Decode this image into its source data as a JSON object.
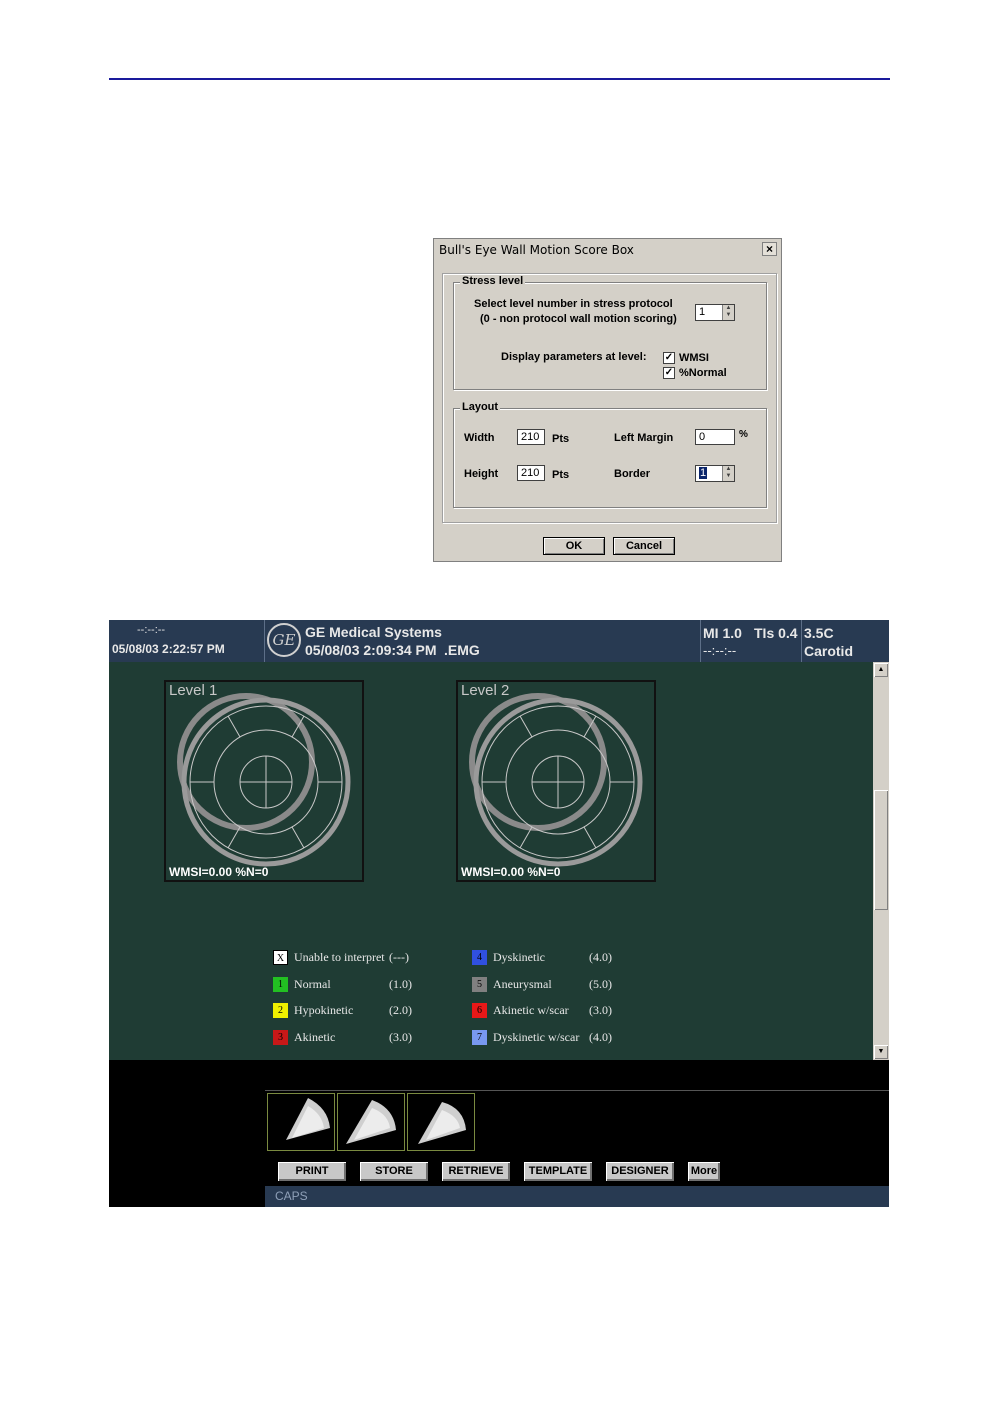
{
  "dialog": {
    "title": "Bull's Eye Wall Motion Score Box",
    "close_label": "×",
    "stress": {
      "legend": "Stress level",
      "prompt_line1": "Select level number in stress protocol",
      "prompt_line2": "(0 - non protocol wall motion scoring)",
      "level_value": "1",
      "display_label": "Display parameters at level:",
      "wmsi_label": "WMSI",
      "wmsi_checked": true,
      "normal_label": "%Normal",
      "normal_checked": true,
      "check_glyph": "✓"
    },
    "layout": {
      "legend": "Layout",
      "width_label": "Width",
      "width_value": "210",
      "width_unit": "Pts",
      "height_label": "Height",
      "height_value": "210",
      "height_unit": "Pts",
      "left_margin_label": "Left Margin",
      "left_margin_value": "0",
      "left_margin_unit": "%",
      "border_label": "Border",
      "border_value": "1"
    },
    "ok_label": "OK",
    "cancel_label": "Cancel"
  },
  "screen": {
    "header": {
      "time_placeholder": "--:--:--",
      "datetime": "05/08/03 2:22:57 PM",
      "logo_text": "GE",
      "company": "GE Medical Systems",
      "exam_datetime": "05/08/03 2:09:34 PM",
      "file_ext": ".EMG",
      "mi": "MI 1.0",
      "tis": "TIs 0.4",
      "probe": "3.5C",
      "time2": "--:--:--",
      "preset": "Carotid"
    },
    "bullseyes": [
      {
        "title": "Level 1",
        "footer": "WMSI=0.00 %N=0"
      },
      {
        "title": "Level 2",
        "footer": "WMSI=0.00 %N=0"
      }
    ],
    "legend": [
      {
        "code": "X",
        "label": "Unable to interpret",
        "value": "(---)",
        "color": "#ffffff"
      },
      {
        "code": "1",
        "label": "Normal",
        "value": "(1.0)",
        "color": "#22c022"
      },
      {
        "code": "2",
        "label": "Hypokinetic",
        "value": "(2.0)",
        "color": "#f0f000"
      },
      {
        "code": "3",
        "label": "Akinetic",
        "value": "(3.0)",
        "color": "#c81818"
      },
      {
        "code": "4",
        "label": "Dyskinetic",
        "value": "(4.0)",
        "color": "#3050e0"
      },
      {
        "code": "5",
        "label": "Aneurysmal",
        "value": "(5.0)",
        "color": "#808080"
      },
      {
        "code": "6",
        "label": "Akinetic w/scar",
        "value": "(3.0)",
        "color": "#e81818"
      },
      {
        "code": "7",
        "label": "Dyskinetic w/scar",
        "value": "(4.0)",
        "color": "#7898f0"
      }
    ],
    "buttons": [
      "PRINT",
      "STORE",
      "RETRIEVE",
      "TEMPLATE",
      "DESIGNER",
      "More"
    ],
    "status": "CAPS"
  }
}
